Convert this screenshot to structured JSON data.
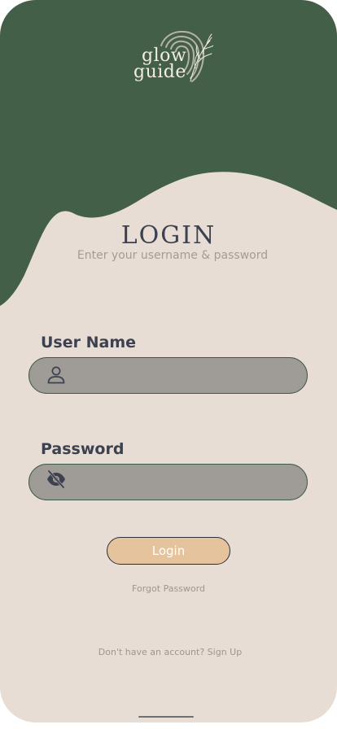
{
  "colors": {
    "header_green": "#445f48",
    "background_beige": "#e8ddd4",
    "field_gray": "#9f9b96",
    "button_tan": "#e5c39c",
    "text_dark": "#3c4150",
    "text_muted": "#a29c98"
  },
  "logo": {
    "line1": "glow",
    "line2": "guide"
  },
  "header": {
    "title": "LOGIN",
    "subtitle": "Enter your username & password"
  },
  "form": {
    "username": {
      "label": "User Name",
      "value": "",
      "placeholder": "",
      "icon": "person-icon"
    },
    "password": {
      "label": "Password",
      "value": "",
      "placeholder": "",
      "icon": "eye-off-icon"
    },
    "submit_label": "Login"
  },
  "links": {
    "forgot_password": "Forgot Password",
    "signup_prompt": "Don't have an account?",
    "signup_link": "Sign Up"
  }
}
